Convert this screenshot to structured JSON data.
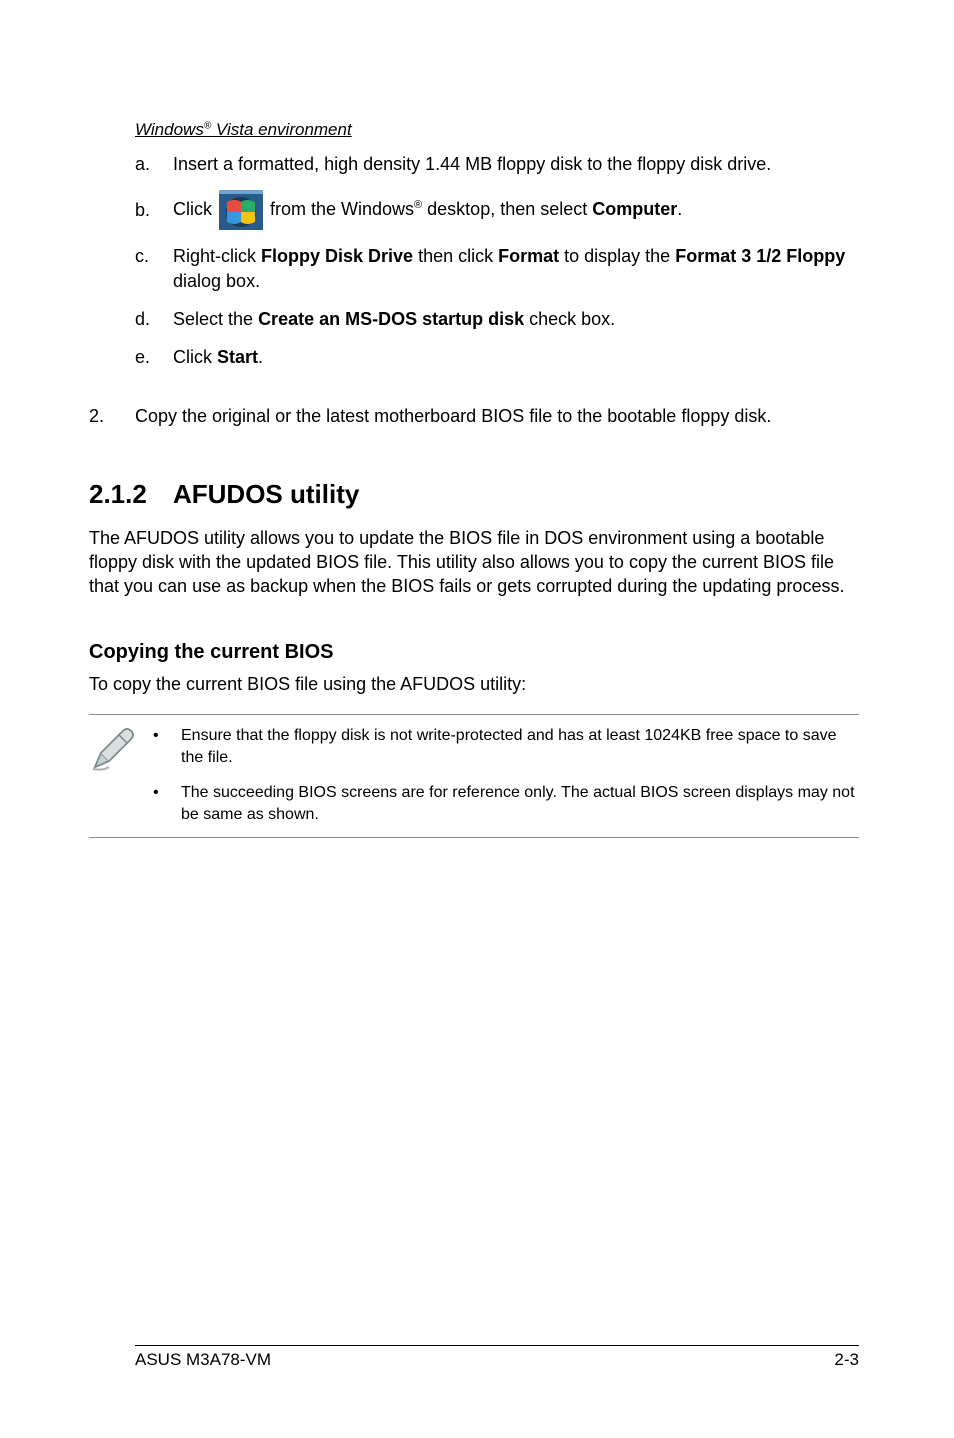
{
  "vista": {
    "heading_pre": "Windows",
    "heading_sup": "®",
    "heading_post": " Vista environment",
    "items": {
      "a": {
        "marker": "a.",
        "text": "Insert a formatted, high density 1.44 MB floppy disk to the floppy disk drive."
      },
      "b": {
        "marker": "b.",
        "pre": "Click ",
        "post_pre": " from the Windows",
        "sup": "®",
        "post_post": " desktop, then select ",
        "bold": "Computer",
        "tail": "."
      },
      "c": {
        "marker": "c.",
        "p1": "Right-click ",
        "b1": "Floppy Disk Drive",
        "p2": " then click ",
        "b2": "Format",
        "p3": " to display the ",
        "b3": "Format 3 1/2 Floppy",
        "p4": " dialog box."
      },
      "d": {
        "marker": "d.",
        "p1": "Select the ",
        "b1": "Create an MS-DOS startup disk",
        "p2": " check box."
      },
      "e": {
        "marker": "e.",
        "p1": "Click ",
        "b1": "Start",
        "p2": "."
      }
    }
  },
  "step2": {
    "marker": "2.",
    "text": "Copy the original or the latest motherboard BIOS file to the bootable floppy disk."
  },
  "afudos": {
    "num": "2.1.2",
    "title": "AFUDOS utility",
    "para": "The AFUDOS utility allows you to update the BIOS file in DOS environment using a bootable floppy disk with the updated BIOS file. This utility also allows you to copy the current BIOS file that you can use as backup when the BIOS fails or gets corrupted during the updating process."
  },
  "copying": {
    "heading": "Copying the current BIOS",
    "intro": "To copy the current BIOS file using the AFUDOS utility:",
    "notes": {
      "n1": "Ensure that the floppy disk is not write-protected and has at least 1024KB free space to save the file.",
      "n2": "The succeeding BIOS screens are for reference only. The actual BIOS screen displays may not be same as shown."
    }
  },
  "footer": {
    "left": "ASUS M3A78-VM",
    "right": "2-3"
  }
}
